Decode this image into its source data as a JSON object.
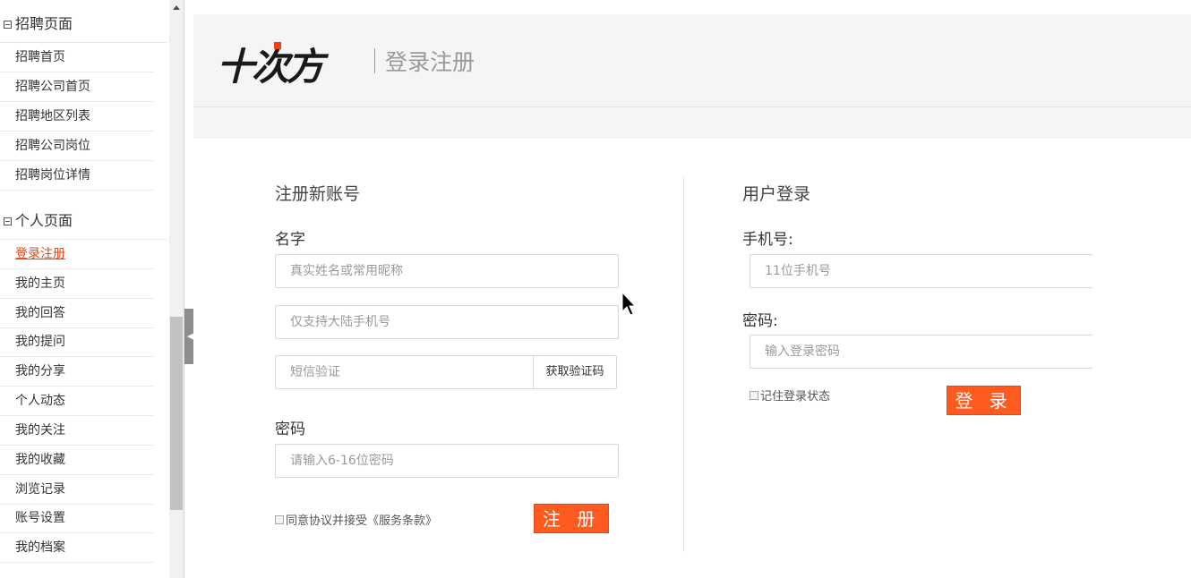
{
  "sidebar": {
    "sections": [
      {
        "title": "招聘页面",
        "items": [
          "招聘首页",
          "招聘公司首页",
          "招聘地区列表",
          "招聘公司岗位",
          "招聘岗位详情"
        ]
      },
      {
        "title": "个人页面",
        "items": [
          "登录注册",
          "我的主页",
          "我的回答",
          "我的提问",
          "我的分享",
          "个人动态",
          "我的关注",
          "我的收藏",
          "浏览记录",
          "账号设置",
          "我的档案"
        ]
      }
    ],
    "active_item": "登录注册"
  },
  "header": {
    "logo_text": "十次方",
    "title": "登录注册"
  },
  "register": {
    "title": "注册新账号",
    "name_label": "名字",
    "name_placeholder": "真实姓名或常用昵称",
    "phone_placeholder": "仅支持大陆手机号",
    "sms_placeholder": "短信验证",
    "sms_button": "获取验证码",
    "password_label": "密码",
    "password_placeholder": "请输入6-16位密码",
    "agree_text": "同意协议并接受《服务条款》",
    "submit_label": "注 册"
  },
  "login": {
    "title": "用户登录",
    "phone_label": "手机号:",
    "phone_placeholder": "11位手机号",
    "password_label": "密码:",
    "password_placeholder": "输入登录密码",
    "remember_text": "记住登录状态",
    "submit_label": "登 录"
  },
  "colors": {
    "accent": "#ff5a1f",
    "active_link": "#e8431a",
    "header_bg": "#f5f5f5"
  }
}
